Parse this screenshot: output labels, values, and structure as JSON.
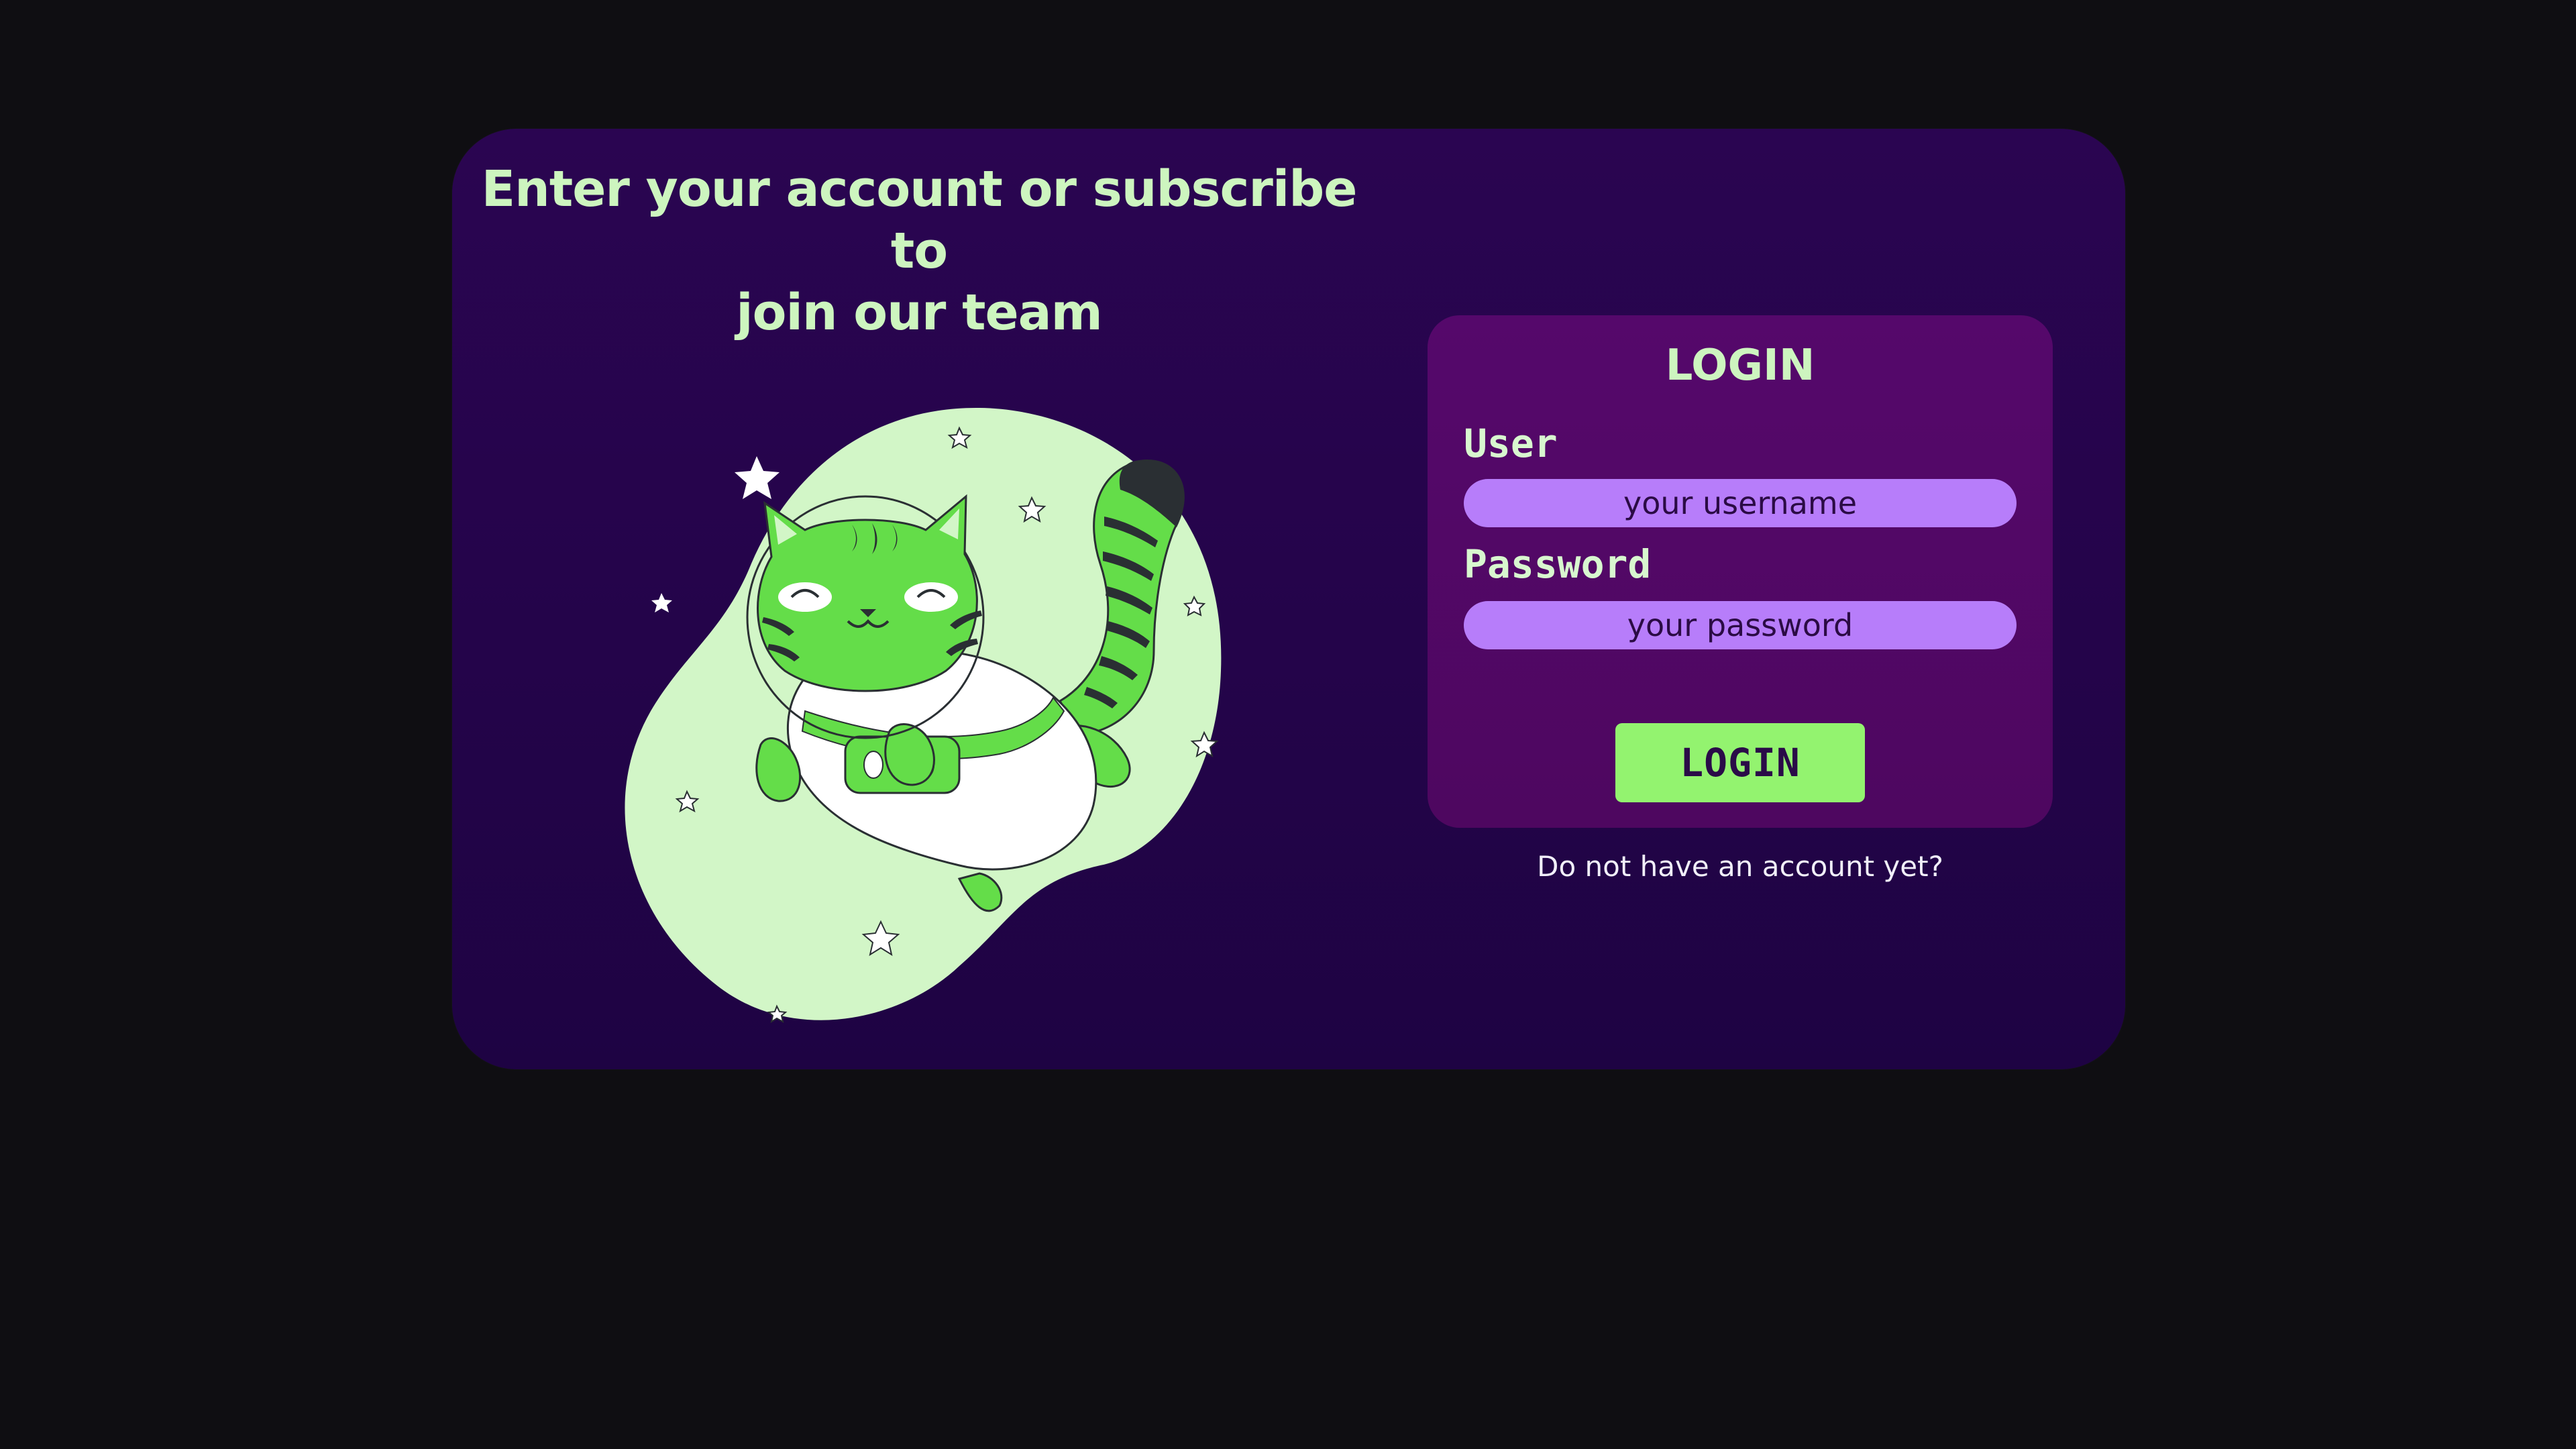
{
  "hero": {
    "headline_line1": "Enter your account or subscribe to",
    "headline_line2": "join our team",
    "illustration_icon": "astronaut-cat-icon"
  },
  "login": {
    "title": "LOGIN",
    "user_label": "User",
    "user_placeholder": "your username",
    "password_label": "Password",
    "password_placeholder": "your password",
    "button_label": "LOGIN",
    "signup_link": "Do not have an account yet?"
  },
  "colors": {
    "page_background": "#0f0e12",
    "card_background": "#27044d",
    "panel_background": "#53086a",
    "accent_text": "#cdf5bf",
    "input_background": "#b77dfa",
    "button_background": "#93f36f"
  }
}
